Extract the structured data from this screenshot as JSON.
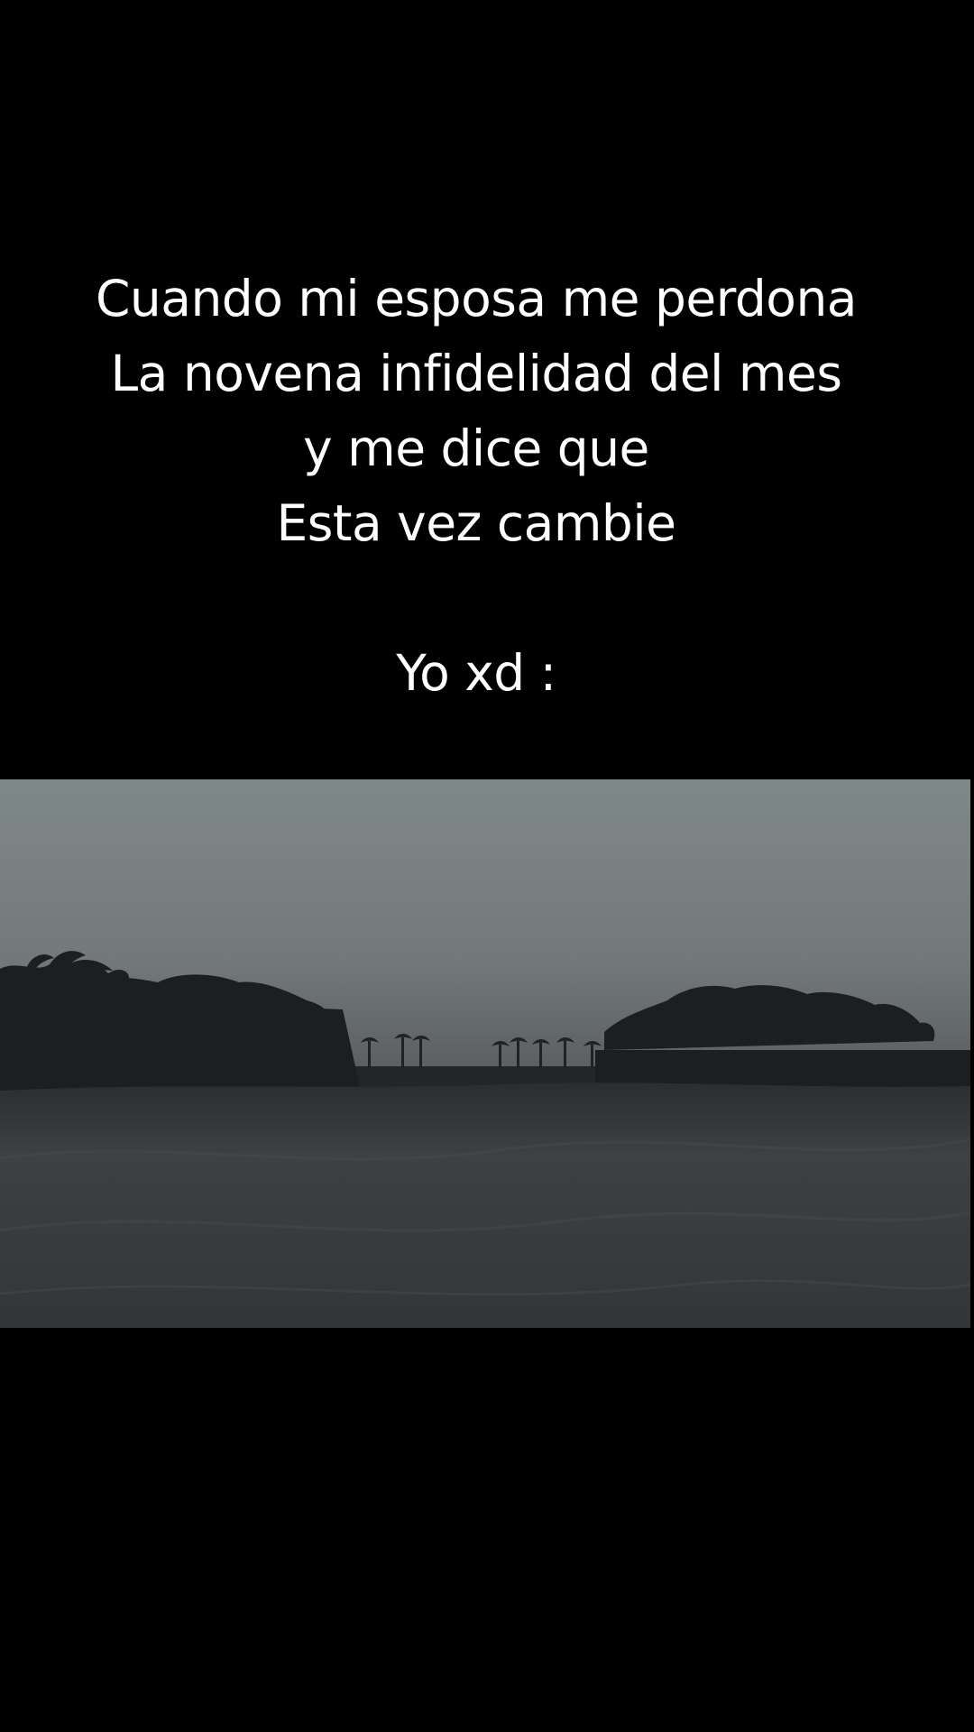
{
  "caption": {
    "line1": "Cuando mi esposa me perdona",
    "line2": "La novena infidelidad del mes",
    "line3": "y me dice que",
    "line4": "Esta vez cambie",
    "line5": "Yo xd :"
  },
  "colors": {
    "background": "#000000",
    "caption_text": "#ffffff",
    "sky": "#7d8384",
    "ground": "#3a3b3d",
    "tree_silhouette": "#1b1d1e"
  }
}
